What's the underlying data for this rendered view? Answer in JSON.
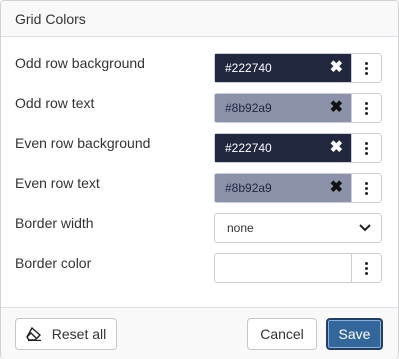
{
  "dialog": {
    "title": "Grid Colors"
  },
  "rows": [
    {
      "label": "Odd row background",
      "value": "#222740",
      "bg": "#222740",
      "fg": "#ffffff",
      "clear_color": "#ffffff"
    },
    {
      "label": "Odd row text",
      "value": "#8b92a9",
      "bg": "#8b92a9",
      "fg": "#222740",
      "clear_color": "#111111"
    },
    {
      "label": "Even row background",
      "value": "#222740",
      "bg": "#222740",
      "fg": "#ffffff",
      "clear_color": "#ffffff"
    },
    {
      "label": "Even row text",
      "value": "#8b92a9",
      "bg": "#8b92a9",
      "fg": "#222740",
      "clear_color": "#111111"
    }
  ],
  "border_width": {
    "label": "Border width",
    "value": "none"
  },
  "border_color": {
    "label": "Border color",
    "value": ""
  },
  "footer": {
    "reset_label": "Reset all",
    "cancel_label": "Cancel",
    "save_label": "Save"
  },
  "icons": {
    "clear": "close-icon",
    "menu": "kebab-menu-icon",
    "dropdown": "chevron-down-icon",
    "reset": "eraser-icon"
  },
  "colors": {
    "save_button": "#33679c",
    "header_bg": "#f9f9f9"
  }
}
